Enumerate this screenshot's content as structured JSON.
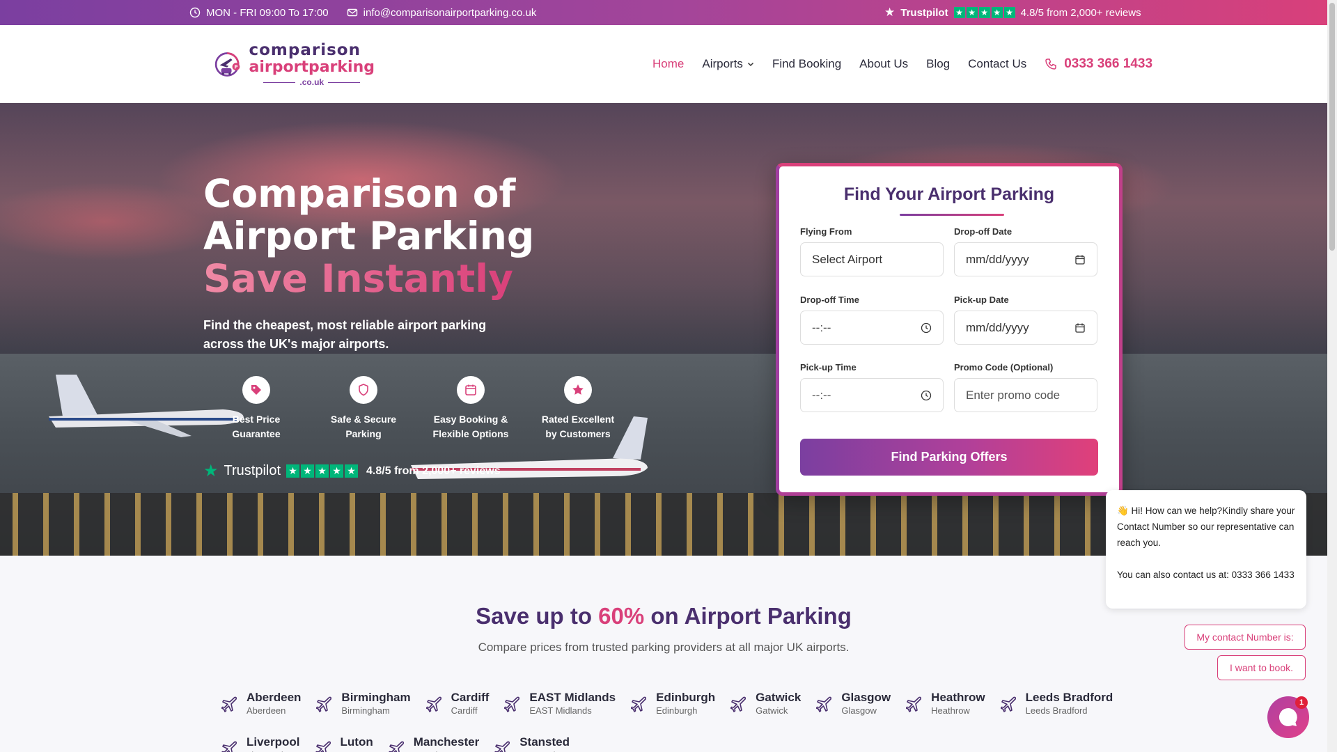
{
  "topbar": {
    "hours": "MON - FRI 09:00 To 17:00",
    "email": "info@comparisonairportparking.co.uk",
    "trustpilot": "Trustpilot",
    "rating": "4.8/5 from 2,000+ reviews"
  },
  "logo": {
    "line1": "comparison",
    "line2": "airportparking",
    "line3": ".co.uk"
  },
  "nav": {
    "items": [
      "Home",
      "Airports",
      "Find Booking",
      "About Us",
      "Blog",
      "Contact Us"
    ],
    "phone": "0333 366 1433"
  },
  "hero": {
    "title_line1": "Comparison of",
    "title_line2": "Airport Parking",
    "title_line3": "Save Instantly",
    "subtitle": "Find the cheapest, most reliable airport parking across the UK's major airports.",
    "features": [
      {
        "line1": "Best Price",
        "line2": "Guarantee",
        "icon": "tag-icon"
      },
      {
        "line1": "Safe & Secure",
        "line2": "Parking",
        "icon": "shield-icon"
      },
      {
        "line1": "Easy Booking &",
        "line2": "Flexible Options",
        "icon": "calendar-icon"
      },
      {
        "line1": "Rated Excellent",
        "line2": "by Customers",
        "icon": "star-icon"
      }
    ],
    "trustpilot": "Trustpilot",
    "rating": "4.8/5 from 2,000+ reviews"
  },
  "form": {
    "title": "Find Your Airport Parking",
    "flying_from_label": "Flying From",
    "flying_from_value": "Select Airport",
    "dropoff_date_label": "Drop-off Date",
    "dropoff_date_value": "mm/dd/yyyy",
    "dropoff_time_label": "Drop-off Time",
    "dropoff_time_value": "--:--",
    "pickup_date_label": "Pick-up Date",
    "pickup_date_value": "mm/dd/yyyy",
    "pickup_time_label": "Pick-up Time",
    "pickup_time_value": "--:--",
    "promo_label": "Promo Code (Optional)",
    "promo_placeholder": "Enter promo code",
    "submit": "Find Parking Offers"
  },
  "savings": {
    "heading_pre": "Save up to ",
    "heading_pct": "60%",
    "heading_post": " on Airport Parking",
    "subtitle": "Compare prices from trusted parking providers at all major UK airports."
  },
  "airports": [
    {
      "name": "Aberdeen",
      "sub": "Aberdeen"
    },
    {
      "name": "Birmingham",
      "sub": "Birmingham"
    },
    {
      "name": "Cardiff",
      "sub": "Cardiff"
    },
    {
      "name": "EAST Midlands",
      "sub": "EAST Midlands"
    },
    {
      "name": "Edinburgh",
      "sub": "Edinburgh"
    },
    {
      "name": "Gatwick",
      "sub": "Gatwick"
    },
    {
      "name": "Glasgow",
      "sub": "Glasgow"
    },
    {
      "name": "Heathrow",
      "sub": "Heathrow"
    },
    {
      "name": "Leeds Bradford",
      "sub": "Leeds Bradford"
    },
    {
      "name": "Liverpool",
      "sub": "Liverpool"
    },
    {
      "name": "Luton",
      "sub": "Luton"
    },
    {
      "name": "Manchester",
      "sub": "Manchester"
    },
    {
      "name": "Stansted",
      "sub": "Stansted"
    }
  ],
  "chat": {
    "message1": "👋 Hi! How can we help?Kindly share your Contact Number so our representative can reach you.",
    "message2": "You can also contact us at: 0333 366 1433",
    "option1": "My contact Number is:",
    "option2": "I want to book.",
    "badge": "1"
  },
  "colors": {
    "brand_purple": "#7b3fa0",
    "brand_pink": "#d9407a",
    "dark_purple": "#4a2f6e",
    "trustpilot_green": "#00b67a"
  }
}
